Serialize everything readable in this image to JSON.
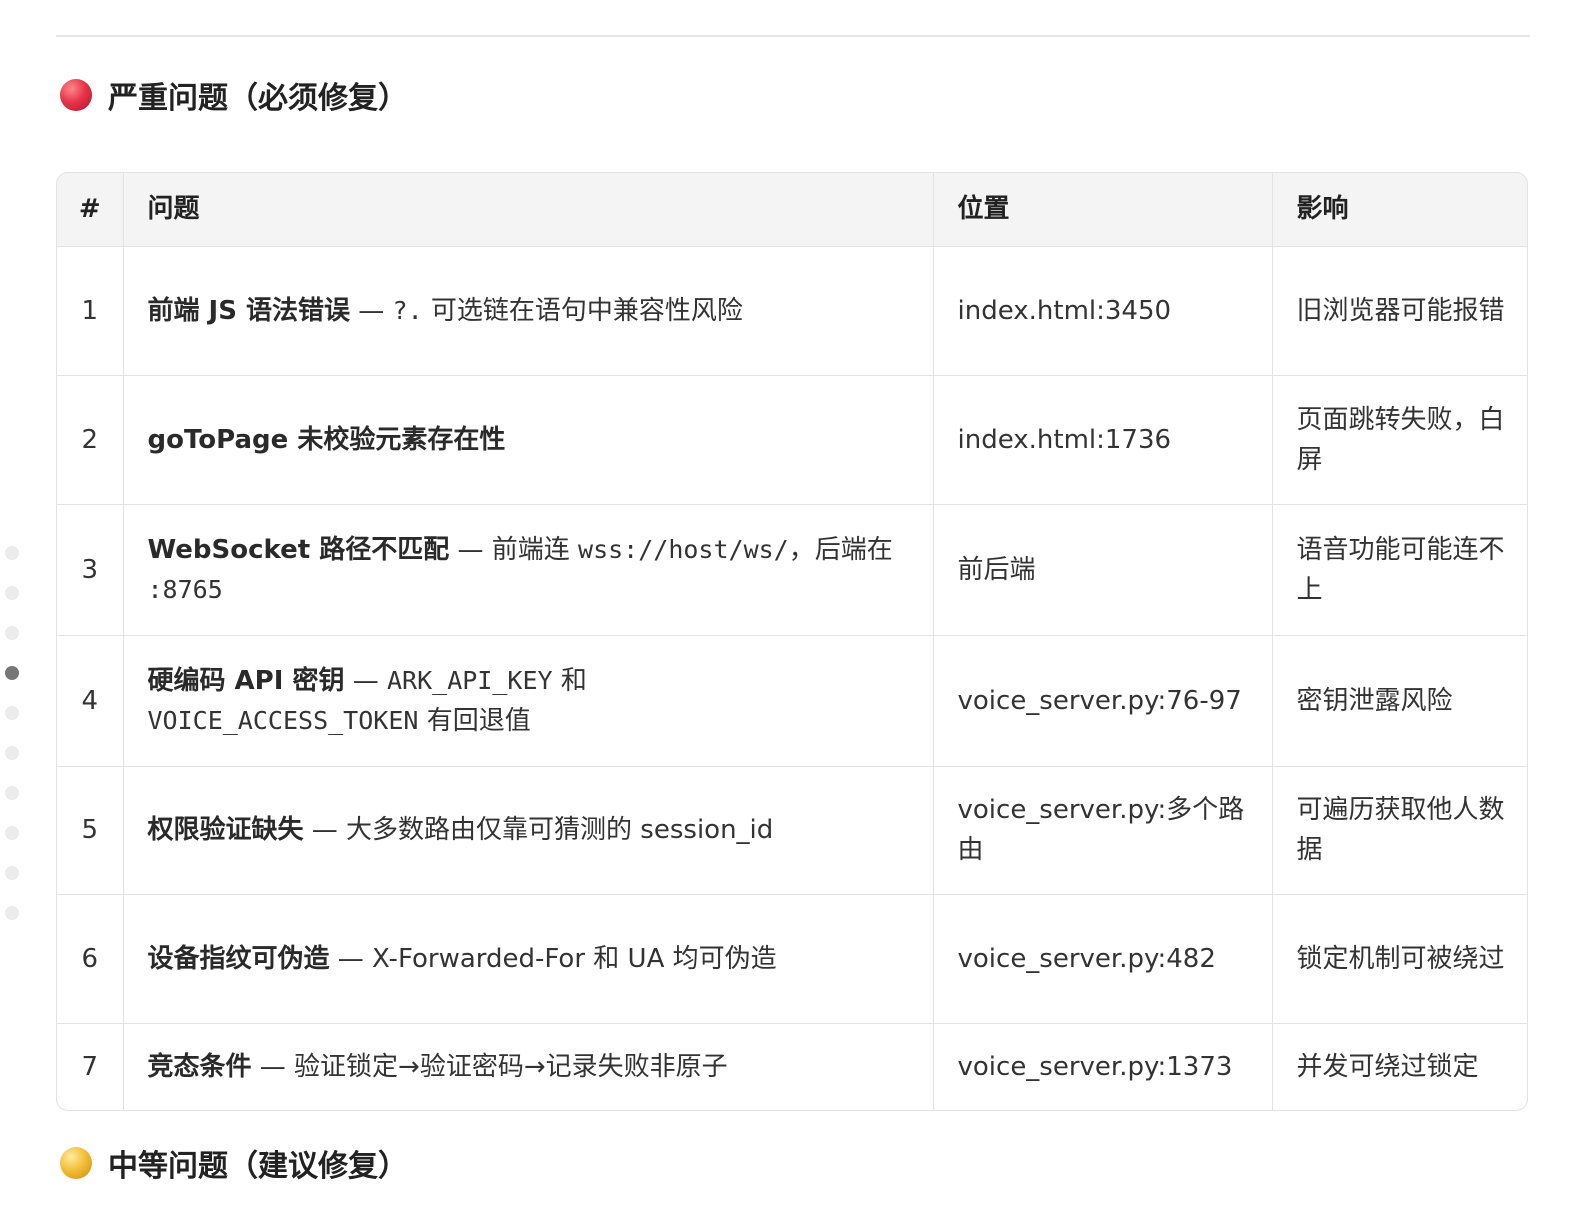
{
  "sections": {
    "critical": {
      "title": "严重问题（必须修复）",
      "dot_color": "#e8344a"
    },
    "medium": {
      "title": "中等问题（建议修复）",
      "dot_color": "#f3c03a"
    }
  },
  "table": {
    "headers": {
      "num": "#",
      "issue": "问题",
      "location": "位置",
      "impact": "影响"
    },
    "rows": [
      {
        "num": "1",
        "issue_bold": "前端 JS 语法错误",
        "issue_text": " — ",
        "issue_code": "?.",
        "issue_text2": " 可选链在语句中兼容性风险",
        "location": "index.html:3450",
        "impact": "旧浏览器可能报错"
      },
      {
        "num": "2",
        "issue_bold": "goToPage 未校验元素存在性",
        "issue_text": "",
        "issue_code": "",
        "issue_text2": "",
        "location": "index.html:1736",
        "impact": "页面跳转失败，白屏"
      },
      {
        "num": "3",
        "issue_bold": "WebSocket 路径不匹配",
        "issue_text": " — 前端连 ",
        "issue_code": "wss://host/ws/",
        "issue_text2": "，后端在 ",
        "issue_code2": ":8765",
        "location": "前后端",
        "impact": "语音功能可能连不上"
      },
      {
        "num": "4",
        "issue_bold": "硬编码 API 密钥",
        "issue_text": " — ",
        "issue_code": "ARK_API_KEY",
        "issue_text2": " 和 ",
        "issue_code2": "VOICE_ACCESS_TOKEN",
        "issue_text3": " 有回退值",
        "location": "voice_server.py:76-97",
        "impact": "密钥泄露风险"
      },
      {
        "num": "5",
        "issue_bold": "权限验证缺失",
        "issue_text": " — 大多数路由仅靠可猜测的 session_id",
        "issue_code": "",
        "issue_text2": "",
        "location": "voice_server.py:多个路由",
        "impact": "可遍历获取他人数据"
      },
      {
        "num": "6",
        "issue_bold": "设备指纹可伪造",
        "issue_text": " — X-Forwarded-For 和 UA 均可伪造",
        "issue_code": "",
        "issue_text2": "",
        "location": "voice_server.py:482",
        "impact": "锁定机制可被绕过"
      },
      {
        "num": "7",
        "issue_bold": "竞态条件",
        "issue_text": " — 验证锁定→验证密码→记录失败非原子",
        "issue_code": "",
        "issue_text2": "",
        "location": "voice_server.py:1373",
        "impact": "并发可绕过锁定"
      }
    ]
  },
  "page_indicator": {
    "total": 10,
    "active_index": 3
  }
}
